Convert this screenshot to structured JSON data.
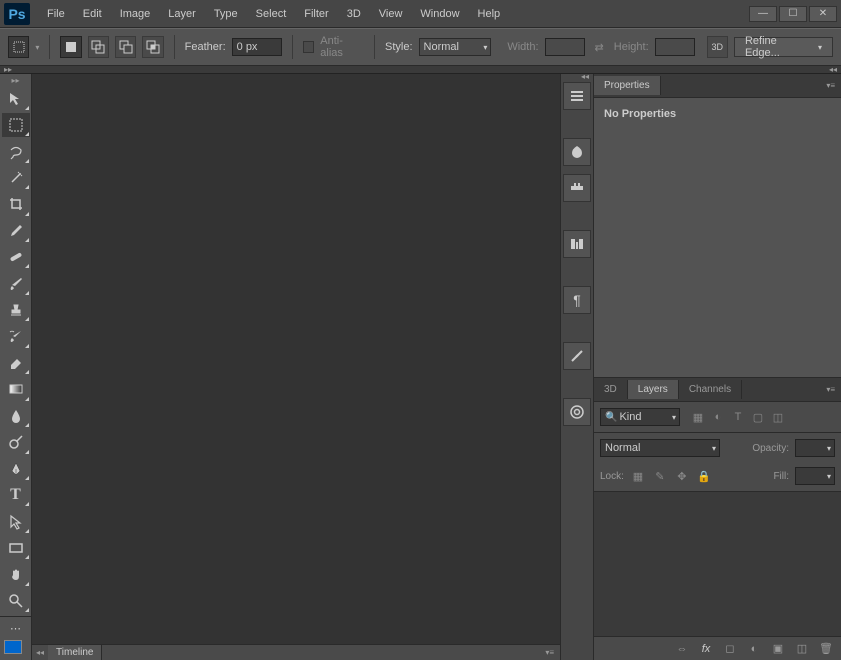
{
  "app": {
    "logo": "Ps"
  },
  "menu": [
    "File",
    "Edit",
    "Image",
    "Layer",
    "Type",
    "Select",
    "Filter",
    "3D",
    "View",
    "Window",
    "Help"
  ],
  "optionbar": {
    "feather_label": "Feather:",
    "feather_value": "0 px",
    "antialias_label": "Anti-alias",
    "style_label": "Style:",
    "style_value": "Normal",
    "width_label": "Width:",
    "height_label": "Height:",
    "threed_label": "3D",
    "refine_label": "Refine Edge..."
  },
  "timeline": {
    "label": "Timeline"
  },
  "properties": {
    "tab": "Properties",
    "empty": "No Properties"
  },
  "layers": {
    "tabs": [
      "3D",
      "Layers",
      "Channels"
    ],
    "active_tab": 1,
    "filter": "Kind",
    "blend": "Normal",
    "opacity_label": "Opacity:",
    "lock_label": "Lock:",
    "fill_label": "Fill:"
  }
}
